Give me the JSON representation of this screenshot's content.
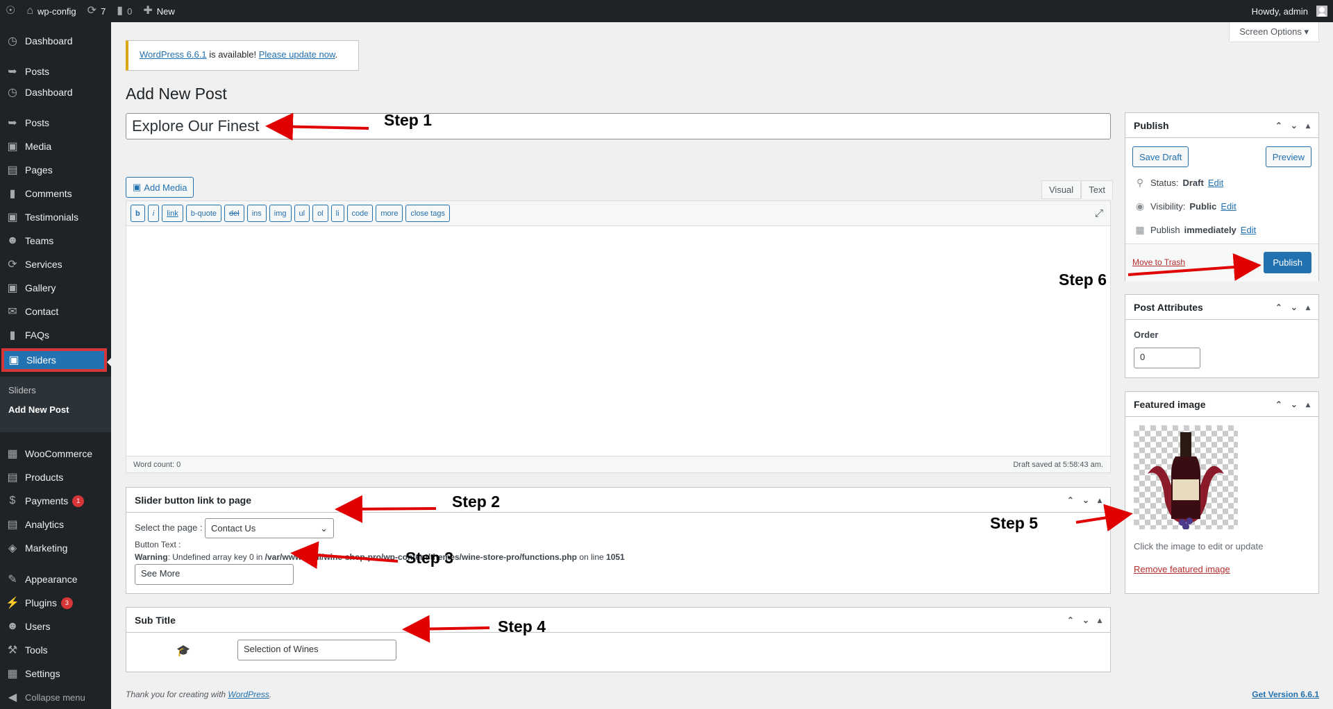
{
  "admin_bar": {
    "site_name": "wp-config",
    "updates_count": "7",
    "comments_count": "0",
    "new_label": "New",
    "howdy": "Howdy, admin"
  },
  "sidebar": {
    "items": [
      {
        "label": "Dashboard",
        "icon": "dashboard-icon"
      },
      {
        "label": "Posts",
        "icon": "pin-icon"
      },
      {
        "label": "Dashboard",
        "icon": "dashboard-icon"
      },
      {
        "label": "Posts",
        "icon": "pin-icon"
      },
      {
        "label": "Media",
        "icon": "media-icon"
      },
      {
        "label": "Pages",
        "icon": "pages-icon"
      },
      {
        "label": "Comments",
        "icon": "comments-icon"
      },
      {
        "label": "Testimonials",
        "icon": "testimonials-icon"
      },
      {
        "label": "Teams",
        "icon": "teams-icon"
      },
      {
        "label": "Services",
        "icon": "services-icon"
      },
      {
        "label": "Gallery",
        "icon": "gallery-icon"
      },
      {
        "label": "Contact",
        "icon": "contact-icon"
      },
      {
        "label": "FAQs",
        "icon": "faqs-icon"
      },
      {
        "label": "Sliders",
        "icon": "sliders-icon"
      }
    ],
    "submenu": [
      "Sliders",
      "Add New Post"
    ],
    "items_after": [
      {
        "label": "WooCommerce",
        "icon": "woocommerce-icon"
      },
      {
        "label": "Products",
        "icon": "products-icon"
      },
      {
        "label": "Payments",
        "icon": "payments-icon",
        "badge": "1"
      },
      {
        "label": "Analytics",
        "icon": "analytics-icon"
      },
      {
        "label": "Marketing",
        "icon": "marketing-icon"
      },
      {
        "label": "Appearance",
        "icon": "appearance-icon"
      },
      {
        "label": "Plugins",
        "icon": "plugins-icon",
        "badge": "3"
      },
      {
        "label": "Users",
        "icon": "users-icon"
      },
      {
        "label": "Tools",
        "icon": "tools-icon"
      },
      {
        "label": "Settings",
        "icon": "settings-icon"
      },
      {
        "label": "Collapse menu",
        "icon": "collapse-icon"
      }
    ]
  },
  "screen_options": "Screen Options",
  "notice": {
    "version_link": "WordPress 6.6.1",
    "text": " is available! ",
    "update_link": "Please update now",
    "end": "."
  },
  "page_title": "Add New Post",
  "post_title": "Explore Our Finest",
  "editor": {
    "add_media": "Add Media",
    "tab_visual": "Visual",
    "tab_text": "Text",
    "quicktags": [
      "b",
      "i",
      "link",
      "b-quote",
      "del",
      "ins",
      "img",
      "ul",
      "ol",
      "li",
      "code",
      "more",
      "close tags"
    ],
    "word_count": "Word count: 0",
    "draft_saved": "Draft saved at 5:58:43 am."
  },
  "slider_box": {
    "title": "Slider button link to page",
    "select_label": "Select the page :",
    "select_value": "Contact Us",
    "button_text_label": "Button Text :",
    "warning_label": "Warning",
    "warning_text": ": Undefined array key 0 in ",
    "warning_path": "/var/www/html/wine-shop-pro/wp-content/themes/wine-store-pro/functions.php",
    "warning_on_line": " on line ",
    "warning_line": "1051",
    "button_text_value": "See More"
  },
  "subtitle_box": {
    "title": "Sub Title",
    "value": "Selection of Wines"
  },
  "publish_box": {
    "title": "Publish",
    "save_draft": "Save Draft",
    "preview": "Preview",
    "status_label": "Status: ",
    "status_value": "Draft",
    "visibility_label": "Visibility: ",
    "visibility_value": "Public",
    "publish_label": "Publish ",
    "publish_value": "immediately",
    "edit": "Edit",
    "move_to_trash": "Move to Trash",
    "publish_button": "Publish"
  },
  "attributes_box": {
    "title": "Post Attributes",
    "order_label": "Order",
    "order_value": "0"
  },
  "featured_box": {
    "title": "Featured image",
    "hint": "Click the image to edit or update",
    "remove": "Remove featured image"
  },
  "footer": {
    "thanks": "Thank you for creating with ",
    "wp_link": "WordPress",
    "thanks_end": ".",
    "version": "Get Version 6.6.1"
  },
  "annotations": {
    "step1": "Step 1",
    "step2": "Step 2",
    "step3": "Step 3",
    "step4": "Step 4",
    "step5": "Step 5",
    "step6": "Step 6"
  },
  "colors": {
    "admin_dark": "#1d2327",
    "accent_blue": "#2271b1",
    "highlight_red": "#d63638",
    "arrow_red": "#e00000"
  }
}
